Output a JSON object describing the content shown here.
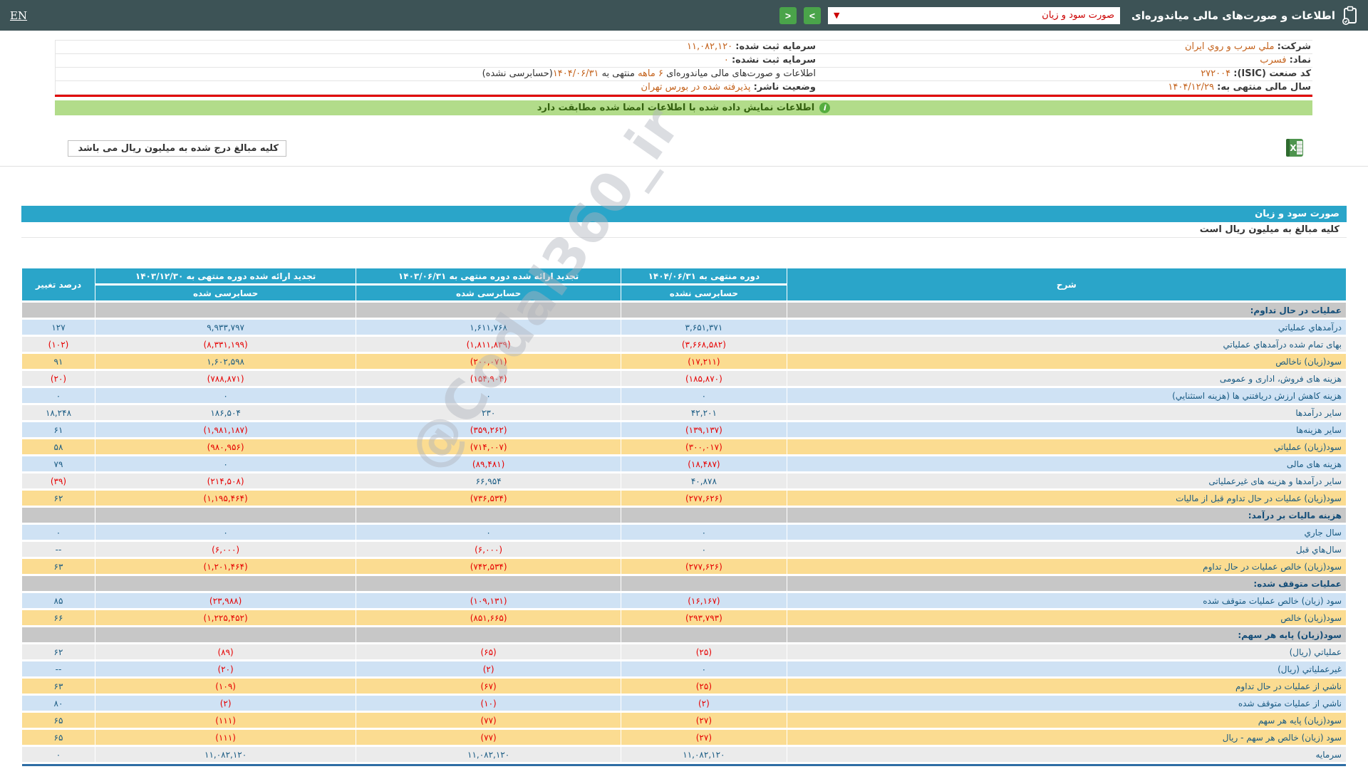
{
  "topbar": {
    "title": "اطلاعات و صورت‌های مالی میاندوره‌ای",
    "dropdown_value": "صورت سود و زیان",
    "dropdown_caret": "▼",
    "next_label": ">",
    "prev_label": "<",
    "en_label": "EN"
  },
  "company": {
    "name_label": "شرکت:",
    "name": "ملي سرب و روي ايران",
    "symbol_label": "نماد:",
    "symbol": "فسرب",
    "isic_label": "کد صنعت (ISIC):",
    "isic": "۲۷۲۰۰۴",
    "fiscal_label": "سال مالی منتهی به:",
    "fiscal": "۱۴۰۴/۱۲/۲۹",
    "capital_label": "سرمایه ثبت شده:",
    "capital": "۱۱,۰۸۲,۱۲۰",
    "unregistered_label": "سرمایه ثبت نشده:",
    "unregistered": "۰",
    "period_prefix": "اطلاعات و صورت‌های مالی میاندوره‌ای",
    "period_months": "۶ ماهه",
    "period_mid": "منتهی به",
    "period_date": "۱۴۰۴/۰۶/۳۱",
    "period_suffix": "(حسابرسی نشده)",
    "status_label": "وضعیت ناشر:",
    "status": "پذيرفته شده در بورس تهران"
  },
  "notice": {
    "text": "اطلاعات نمایش داده شده با اطلاعات امضا شده مطابقت دارد",
    "icon": "i"
  },
  "units_note": "کلیه مبالغ درج شده به میلیون ریال می باشد",
  "section": {
    "title": "صورت سود و زیان",
    "subtitle": "کلیه مبالغ به میلیون ریال است"
  },
  "watermark": "@Codal360_ir",
  "colors": {
    "topbar_bg": "#3d5356",
    "accent_blue": "#2aa5c9",
    "row_blue": "#cfe2f4",
    "row_gray": "#ebebeb",
    "row_yellow": "#fbdc91",
    "row_section": "#c7c7c7",
    "negative_red": "#e60000",
    "positive_blue": "#1a5b83",
    "value_orange": "#c4621c",
    "notice_green": "#b2dc8a",
    "alert_red_line": "#e00000",
    "nav_green": "#4aa44a"
  },
  "table": {
    "headers": {
      "desc": "شرح",
      "col1_line1": "دوره منتهی به ۱۴۰۴/۰۶/۳۱",
      "col1_line2": "حسابرسی نشده",
      "col2_line1": "تجدید ارائه شده دوره منتهی به ۱۴۰۳/۰۶/۳۱",
      "col2_line2": "حسابرسی شده",
      "col3_line1": "تجدید ارائه شده دوره منتهی به ۱۴۰۳/۱۲/۳۰",
      "col3_line2": "حسابرسی شده",
      "change": "درصد تغییر"
    },
    "rows": [
      {
        "type": "section",
        "bg": "section",
        "label": "عملیات در حال تداوم:"
      },
      {
        "type": "data",
        "bg": "blue",
        "label": "درآمدهاي عملياتي",
        "values": [
          "۳,۶۵۱,۳۷۱",
          "۱,۶۱۱,۷۶۸",
          "۹,۹۳۳,۷۹۷"
        ],
        "change": "۱۲۷"
      },
      {
        "type": "data",
        "bg": "gray",
        "label": "بهای تمام شده درآمدهاي عملياتي",
        "values": [
          "(۳,۶۶۸,۵۸۲)",
          "(۱,۸۱۱,۸۳۹)",
          "(۸,۳۳۱,۱۹۹)"
        ],
        "change": "(۱۰۲)"
      },
      {
        "type": "data",
        "bg": "yellow",
        "label": "سود(زیان) ناخالص",
        "values": [
          "(۱۷,۲۱۱)",
          "(۲۰۰,۰۷۱)",
          "۱,۶۰۲,۵۹۸"
        ],
        "change": "۹۱"
      },
      {
        "type": "data",
        "bg": "gray",
        "label": "هزینه های فروش، اداری و عمومی",
        "values": [
          "(۱۸۵,۸۷۰)",
          "(۱۵۴,۹۰۴)",
          "(۷۸۸,۸۷۱)"
        ],
        "change": "(۲۰)"
      },
      {
        "type": "data",
        "bg": "blue",
        "label": "هزینه کاهش ارزش دریافتني ها (هزینه استثنايي)",
        "values": [
          "۰",
          "۰",
          "۰"
        ],
        "change": "۰"
      },
      {
        "type": "data",
        "bg": "gray",
        "label": "سایر درآمدها",
        "values": [
          "۴۲,۲۰۱",
          "۲۳۰",
          "۱۸۶,۵۰۴"
        ],
        "change": "۱۸,۲۴۸"
      },
      {
        "type": "data",
        "bg": "blue",
        "label": "سایر هزینه‌ها",
        "values": [
          "(۱۳۹,۱۳۷)",
          "(۳۵۹,۲۶۲)",
          "(۱,۹۸۱,۱۸۷)"
        ],
        "change": "۶۱"
      },
      {
        "type": "data",
        "bg": "yellow",
        "label": "سود(زیان) عملیاتي",
        "values": [
          "(۳۰۰,۰۱۷)",
          "(۷۱۴,۰۰۷)",
          "(۹۸۰,۹۵۶)"
        ],
        "change": "۵۸"
      },
      {
        "type": "data",
        "bg": "blue",
        "label": "هزینه های مالی",
        "values": [
          "(۱۸,۴۸۷)",
          "(۸۹,۴۸۱)",
          "۰"
        ],
        "change": "۷۹"
      },
      {
        "type": "data",
        "bg": "gray",
        "label": "سایر درآمدها و هزینه های غیرعملیاتی",
        "values": [
          "۴۰,۸۷۸",
          "۶۶,۹۵۴",
          "(۲۱۴,۵۰۸)"
        ],
        "change": "(۳۹)"
      },
      {
        "type": "data",
        "bg": "yellow",
        "label": "سود(زیان) عملیات در حال تداوم قبل از مالیات",
        "values": [
          "(۲۷۷,۶۲۶)",
          "(۷۳۶,۵۳۴)",
          "(۱,۱۹۵,۴۶۴)"
        ],
        "change": "۶۲"
      },
      {
        "type": "section",
        "bg": "section",
        "label": "هزینه مالیات بر درآمد:"
      },
      {
        "type": "data",
        "bg": "blue",
        "label": "سال جاري",
        "values": [
          "۰",
          "۰",
          "۰"
        ],
        "change": "۰"
      },
      {
        "type": "data",
        "bg": "gray",
        "label": "سال‌هاي قبل",
        "values": [
          "۰",
          "(۶,۰۰۰)",
          "(۶,۰۰۰)"
        ],
        "change": "--"
      },
      {
        "type": "data",
        "bg": "yellow",
        "label": "سود(زیان) خالص عملیات در حال تداوم",
        "values": [
          "(۲۷۷,۶۲۶)",
          "(۷۴۲,۵۳۴)",
          "(۱,۲۰۱,۴۶۴)"
        ],
        "change": "۶۳"
      },
      {
        "type": "section",
        "bg": "section",
        "label": "عملیات متوقف شده:"
      },
      {
        "type": "data",
        "bg": "blue",
        "label": "سود (زیان) خالص عملیات متوقف شده",
        "values": [
          "(۱۶,۱۶۷)",
          "(۱۰۹,۱۳۱)",
          "(۲۳,۹۸۸)"
        ],
        "change": "۸۵"
      },
      {
        "type": "data",
        "bg": "yellow",
        "label": "سود(زیان) خالص",
        "values": [
          "(۲۹۳,۷۹۳)",
          "(۸۵۱,۶۶۵)",
          "(۱,۲۲۵,۴۵۲)"
        ],
        "change": "۶۶"
      },
      {
        "type": "section",
        "bg": "section",
        "label": "سود(زیان) پایه هر سهم:"
      },
      {
        "type": "data",
        "bg": "gray",
        "label": "عملیاتي (ریال)",
        "values": [
          "(۲۵)",
          "(۶۵)",
          "(۸۹)"
        ],
        "change": "۶۲"
      },
      {
        "type": "data",
        "bg": "blue",
        "label": "غیرعملیاتي (ریال)",
        "values": [
          "۰",
          "(۲)",
          "(۲۰)"
        ],
        "change": "--"
      },
      {
        "type": "data",
        "bg": "yellow",
        "label": "ناشي از عملیات در حال تداوم",
        "values": [
          "(۲۵)",
          "(۶۷)",
          "(۱۰۹)"
        ],
        "change": "۶۳"
      },
      {
        "type": "data",
        "bg": "blue",
        "label": "ناشي از عملیات متوقف شده",
        "values": [
          "(۲)",
          "(۱۰)",
          "(۲)"
        ],
        "change": "۸۰"
      },
      {
        "type": "data",
        "bg": "yellow",
        "label": "سود(زیان) پایه هر سهم",
        "values": [
          "(۲۷)",
          "(۷۷)",
          "(۱۱۱)"
        ],
        "change": "۶۵"
      },
      {
        "type": "data",
        "bg": "yellow",
        "label": "سود (زیان) خالص هر سهم - ریال",
        "values": [
          "(۲۷)",
          "(۷۷)",
          "(۱۱۱)"
        ],
        "change": "۶۵"
      },
      {
        "type": "data",
        "bg": "gray",
        "label": "سرمایه",
        "values": [
          "۱۱,۰۸۲,۱۲۰",
          "۱۱,۰۸۲,۱۲۰",
          "۱۱,۰۸۲,۱۲۰"
        ],
        "change": "۰"
      }
    ]
  }
}
